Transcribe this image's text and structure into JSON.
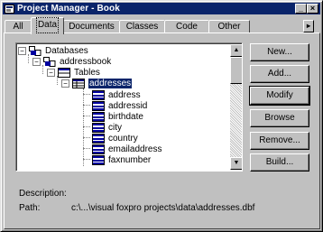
{
  "window": {
    "title": "Project Manager - Book"
  },
  "title_buttons": {
    "minimize": "_",
    "close": "×"
  },
  "tabs": [
    {
      "label": "All",
      "active": false
    },
    {
      "label": "Data",
      "active": true
    },
    {
      "label": "Documents",
      "active": false
    },
    {
      "label": "Classes",
      "active": false
    },
    {
      "label": "Code",
      "active": false
    },
    {
      "label": "Other",
      "active": false
    }
  ],
  "tab_scroll_label": "▸",
  "tree": {
    "databases": "Databases",
    "database": "addressbook",
    "tables": "Tables",
    "selected_table": "addresses",
    "fields": [
      "address",
      "addressid",
      "birthdate",
      "city",
      "country",
      "emailaddress",
      "faxnumber"
    ]
  },
  "expanders": {
    "databases": "−",
    "database": "−",
    "tables": "−",
    "selected_table": "−"
  },
  "scroll": {
    "up": "▲",
    "down": "▼"
  },
  "buttons": {
    "new": "New...",
    "add": "Add...",
    "modify": "Modify",
    "browse": "Browse",
    "remove": "Remove...",
    "build": "Build..."
  },
  "description_label": "Description:",
  "path_label": "Path:",
  "path_value": "c:\\...\\visual foxpro projects\\data\\addresses.dbf",
  "colors": {
    "title_bar": "#0a246a",
    "face": "#c0c0c0",
    "selection": "#0a246a"
  }
}
